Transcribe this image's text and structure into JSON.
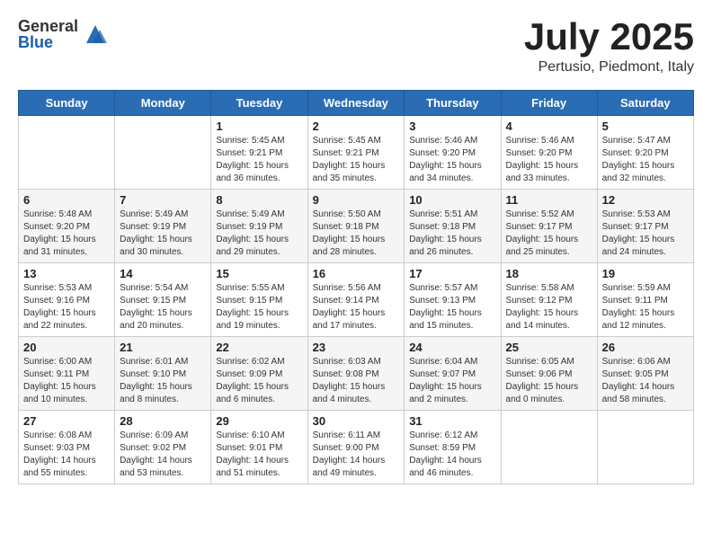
{
  "header": {
    "logo_general": "General",
    "logo_blue": "Blue",
    "month_title": "July 2025",
    "location": "Pertusio, Piedmont, Italy"
  },
  "calendar": {
    "days_of_week": [
      "Sunday",
      "Monday",
      "Tuesday",
      "Wednesday",
      "Thursday",
      "Friday",
      "Saturday"
    ],
    "weeks": [
      [
        {
          "day": "",
          "info": ""
        },
        {
          "day": "",
          "info": ""
        },
        {
          "day": "1",
          "info": "Sunrise: 5:45 AM\nSunset: 9:21 PM\nDaylight: 15 hours and 36 minutes."
        },
        {
          "day": "2",
          "info": "Sunrise: 5:45 AM\nSunset: 9:21 PM\nDaylight: 15 hours and 35 minutes."
        },
        {
          "day": "3",
          "info": "Sunrise: 5:46 AM\nSunset: 9:20 PM\nDaylight: 15 hours and 34 minutes."
        },
        {
          "day": "4",
          "info": "Sunrise: 5:46 AM\nSunset: 9:20 PM\nDaylight: 15 hours and 33 minutes."
        },
        {
          "day": "5",
          "info": "Sunrise: 5:47 AM\nSunset: 9:20 PM\nDaylight: 15 hours and 32 minutes."
        }
      ],
      [
        {
          "day": "6",
          "info": "Sunrise: 5:48 AM\nSunset: 9:20 PM\nDaylight: 15 hours and 31 minutes."
        },
        {
          "day": "7",
          "info": "Sunrise: 5:49 AM\nSunset: 9:19 PM\nDaylight: 15 hours and 30 minutes."
        },
        {
          "day": "8",
          "info": "Sunrise: 5:49 AM\nSunset: 9:19 PM\nDaylight: 15 hours and 29 minutes."
        },
        {
          "day": "9",
          "info": "Sunrise: 5:50 AM\nSunset: 9:18 PM\nDaylight: 15 hours and 28 minutes."
        },
        {
          "day": "10",
          "info": "Sunrise: 5:51 AM\nSunset: 9:18 PM\nDaylight: 15 hours and 26 minutes."
        },
        {
          "day": "11",
          "info": "Sunrise: 5:52 AM\nSunset: 9:17 PM\nDaylight: 15 hours and 25 minutes."
        },
        {
          "day": "12",
          "info": "Sunrise: 5:53 AM\nSunset: 9:17 PM\nDaylight: 15 hours and 24 minutes."
        }
      ],
      [
        {
          "day": "13",
          "info": "Sunrise: 5:53 AM\nSunset: 9:16 PM\nDaylight: 15 hours and 22 minutes."
        },
        {
          "day": "14",
          "info": "Sunrise: 5:54 AM\nSunset: 9:15 PM\nDaylight: 15 hours and 20 minutes."
        },
        {
          "day": "15",
          "info": "Sunrise: 5:55 AM\nSunset: 9:15 PM\nDaylight: 15 hours and 19 minutes."
        },
        {
          "day": "16",
          "info": "Sunrise: 5:56 AM\nSunset: 9:14 PM\nDaylight: 15 hours and 17 minutes."
        },
        {
          "day": "17",
          "info": "Sunrise: 5:57 AM\nSunset: 9:13 PM\nDaylight: 15 hours and 15 minutes."
        },
        {
          "day": "18",
          "info": "Sunrise: 5:58 AM\nSunset: 9:12 PM\nDaylight: 15 hours and 14 minutes."
        },
        {
          "day": "19",
          "info": "Sunrise: 5:59 AM\nSunset: 9:11 PM\nDaylight: 15 hours and 12 minutes."
        }
      ],
      [
        {
          "day": "20",
          "info": "Sunrise: 6:00 AM\nSunset: 9:11 PM\nDaylight: 15 hours and 10 minutes."
        },
        {
          "day": "21",
          "info": "Sunrise: 6:01 AM\nSunset: 9:10 PM\nDaylight: 15 hours and 8 minutes."
        },
        {
          "day": "22",
          "info": "Sunrise: 6:02 AM\nSunset: 9:09 PM\nDaylight: 15 hours and 6 minutes."
        },
        {
          "day": "23",
          "info": "Sunrise: 6:03 AM\nSunset: 9:08 PM\nDaylight: 15 hours and 4 minutes."
        },
        {
          "day": "24",
          "info": "Sunrise: 6:04 AM\nSunset: 9:07 PM\nDaylight: 15 hours and 2 minutes."
        },
        {
          "day": "25",
          "info": "Sunrise: 6:05 AM\nSunset: 9:06 PM\nDaylight: 15 hours and 0 minutes."
        },
        {
          "day": "26",
          "info": "Sunrise: 6:06 AM\nSunset: 9:05 PM\nDaylight: 14 hours and 58 minutes."
        }
      ],
      [
        {
          "day": "27",
          "info": "Sunrise: 6:08 AM\nSunset: 9:03 PM\nDaylight: 14 hours and 55 minutes."
        },
        {
          "day": "28",
          "info": "Sunrise: 6:09 AM\nSunset: 9:02 PM\nDaylight: 14 hours and 53 minutes."
        },
        {
          "day": "29",
          "info": "Sunrise: 6:10 AM\nSunset: 9:01 PM\nDaylight: 14 hours and 51 minutes."
        },
        {
          "day": "30",
          "info": "Sunrise: 6:11 AM\nSunset: 9:00 PM\nDaylight: 14 hours and 49 minutes."
        },
        {
          "day": "31",
          "info": "Sunrise: 6:12 AM\nSunset: 8:59 PM\nDaylight: 14 hours and 46 minutes."
        },
        {
          "day": "",
          "info": ""
        },
        {
          "day": "",
          "info": ""
        }
      ]
    ]
  }
}
